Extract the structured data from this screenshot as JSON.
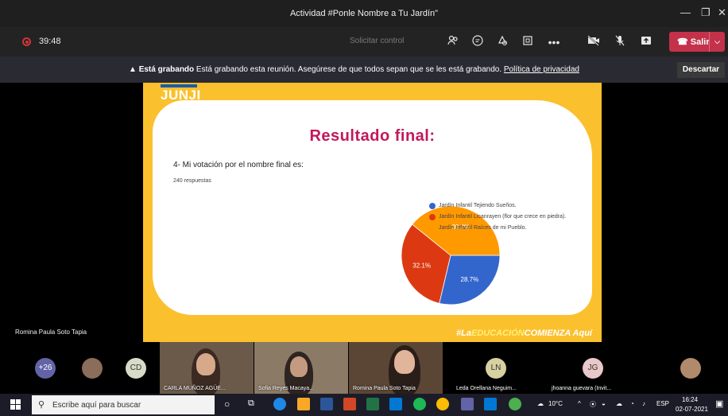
{
  "window": {
    "title": "Actividad #Ponle Nombre a Tu Jardín\"",
    "minimize": "—",
    "maximize": "❐",
    "close": "✕"
  },
  "toolbar": {
    "timer": "39:48",
    "request_control": "Solicitar control",
    "leave_label": "Salir",
    "leave_chevron": "⌵"
  },
  "banner": {
    "bold": "Está grabando",
    "text": " Está grabando esta reunión. Asegúrese de que todos sepan que se les está grabando. ",
    "link": "Política de privacidad",
    "dismiss": "Descartar"
  },
  "slide": {
    "logo": "JUNJI",
    "title": "Resultado final:",
    "question": "4- Mi votación por el nombre final es:",
    "responses": "240 respuestas",
    "hashtag_prefix": "#La",
    "hashtag_edu": "EDUCACIÓN",
    "hashtag_mid": "COMIENZA",
    "hashtag_suffix": "Aquí"
  },
  "chart_data": {
    "type": "pie",
    "series": [
      {
        "name": "Jardín Infantil Tejiendo Sueños.",
        "value": 28.7,
        "label": "28.7%",
        "color": "#3366cc"
      },
      {
        "name": "Jardín Infantil Licanrayen (flor que crece en piedra).",
        "value": 32.1,
        "label": "32.1%",
        "color": "#dc3912"
      },
      {
        "name": "Jardín Infantil Raíces de mi Pueblo.",
        "value": 39.2,
        "label": "39.2%",
        "color": "#ff9900"
      }
    ]
  },
  "legend": {
    "item1": "Jardín Infantil Tejiendo Sueños.",
    "item2": "Jardín Infantil Licanrayen (flor que crece en piedra).",
    "item3": "Jardín Infantil Raíces de mi Pueblo."
  },
  "presenter": {
    "name": "Romina Paula Soto Tapia"
  },
  "participants": {
    "more": "+26",
    "cd": "CD",
    "tile1": "CARLA MUÑOZ AGÜE...",
    "tile2": "Sofia Reyes Macaya...",
    "tile3": "Romina Paula Soto Tapia",
    "ln_initials": "LN",
    "ln_name": "Leda Orellana Neguim...",
    "jg_initials": "JG",
    "jg_name": "jhoanna guevara (Invit..."
  },
  "taskbar": {
    "search_placeholder": "Escribe aquí para buscar",
    "temperature": "10°C",
    "language": "ESP",
    "time": "16:24",
    "date": "02-07-2021"
  }
}
